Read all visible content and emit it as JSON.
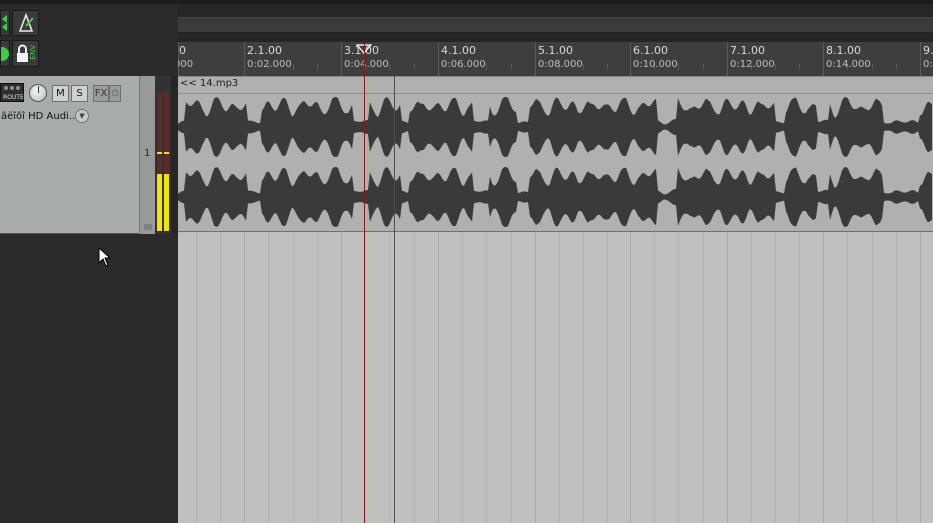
{
  "ruler": {
    "marks": [
      {
        "bar": "0",
        "time": "000"
      },
      {
        "bar": "2.1.00",
        "time": "0:02.000"
      },
      {
        "bar": "3.1.00",
        "time": "0:04.000"
      },
      {
        "bar": "4.1.00",
        "time": "0:06.000"
      },
      {
        "bar": "5.1.00",
        "time": "0:08.000"
      },
      {
        "bar": "6.1.00",
        "time": "0:10.000"
      },
      {
        "bar": "7.1.00",
        "time": "0:12.000"
      },
      {
        "bar": "8.1.00",
        "time": "0:14.000"
      },
      {
        "bar": "9.",
        "time": "0:"
      }
    ]
  },
  "track": {
    "number": "1",
    "route_label": "ROUTE",
    "mute_label": "M",
    "solo_label": "S",
    "fx_label": "FX",
    "input_label": "ãëîõî HD Audi..1"
  },
  "toolbar": {
    "env_label": "ENV"
  },
  "item": {
    "name": "<< 14.mp3"
  },
  "colors": {
    "arrange_bg": "#bfc1bf",
    "waveform": "#3a3a3a",
    "edit_cursor": "#8b0000",
    "meter_peak": "#f2e600"
  }
}
